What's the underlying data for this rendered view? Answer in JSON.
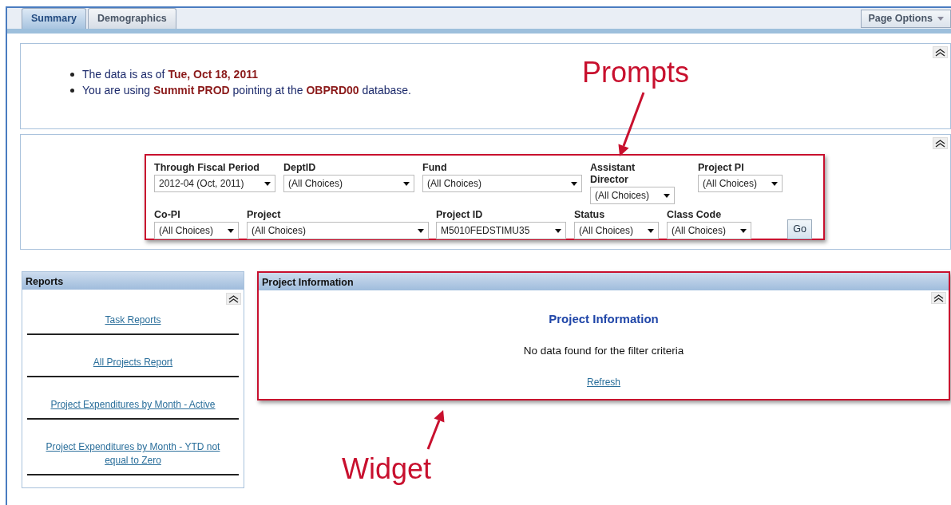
{
  "tabs": [
    {
      "label": "Summary",
      "selected": true
    },
    {
      "label": "Demographics",
      "selected": false
    }
  ],
  "page_options": {
    "label": "Page Options"
  },
  "info": {
    "bullets": [
      "The data is as of **Tue, Oct 18, 2011**",
      "You are using **Summit PROD** pointing at the **OBPRD00** database."
    ]
  },
  "prompts": {
    "rows": [
      [
        {
          "label": "Through Fiscal Period",
          "value": "2012-04 (Oct, 2011)"
        },
        {
          "label": "DeptID",
          "value": "(All Choices)"
        },
        {
          "label": "Fund",
          "value": "(All Choices)"
        },
        {
          "label": "Assistant Director",
          "value": "(All Choices)"
        },
        {
          "label": "Project PI",
          "value": "(All Choices)"
        }
      ],
      [
        {
          "label": "Co-PI",
          "value": "(All Choices)"
        },
        {
          "label": "Project",
          "value": "(All Choices)"
        },
        {
          "label": "Project ID",
          "value": "M5010FEDSTIMU35"
        },
        {
          "label": "Status",
          "value": "(All Choices)"
        },
        {
          "label": "Class Code",
          "value": "(All Choices)"
        }
      ]
    ],
    "go_button": "Go"
  },
  "reports": {
    "title": "Reports",
    "links": [
      "Task Reports",
      "All Projects Report",
      "Project Expenditures by Month - Active",
      "Project Expenditures by Month - YTD not equal to Zero"
    ]
  },
  "project_info": {
    "title": "Project Information",
    "heading": "Project Information",
    "message": "No data found for the filter criteria",
    "refresh": "Refresh"
  },
  "annotations": [
    {
      "kind": "prompts",
      "text": "Prompts"
    },
    {
      "kind": "widget",
      "text": "Widget"
    }
  ]
}
